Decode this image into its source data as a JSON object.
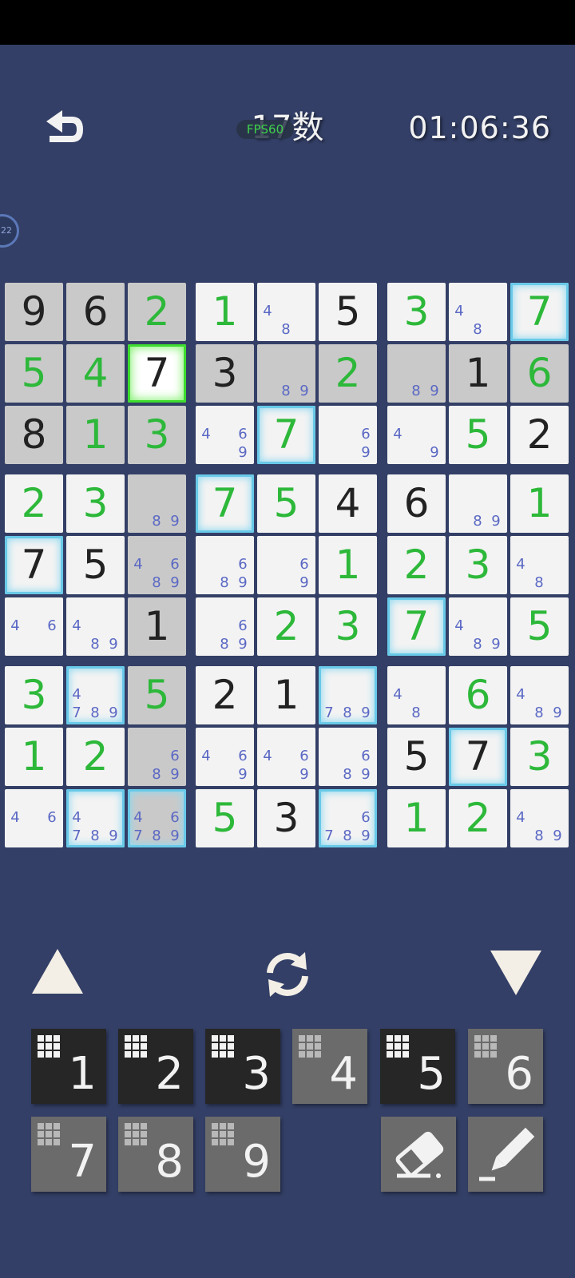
{
  "header": {
    "title": "17数",
    "fps": "FPS60",
    "timer": "01:06:36",
    "badge": "22"
  },
  "colors": {
    "background": "#333f66",
    "given_digit": "#222222",
    "user_digit": "#2db83a",
    "note_digit": "#5a68c4",
    "highlight": "#69c9e8",
    "selected": "#3ddc2f"
  },
  "board": {
    "rows": [
      [
        {
          "v": "9",
          "t": "given",
          "gray": true
        },
        {
          "v": "6",
          "t": "given",
          "gray": true
        },
        {
          "v": "2",
          "t": "user",
          "gray": true
        },
        {
          "v": "1",
          "t": "user"
        },
        {
          "n": [
            "4",
            "8"
          ]
        },
        {
          "v": "5",
          "t": "given"
        },
        {
          "v": "3",
          "t": "user"
        },
        {
          "n": [
            "4",
            "8"
          ]
        },
        {
          "v": "7",
          "t": "user",
          "glow": true
        }
      ],
      [
        {
          "v": "5",
          "t": "user",
          "gray": true
        },
        {
          "v": "4",
          "t": "user",
          "gray": true
        },
        {
          "v": "7",
          "t": "given",
          "selected": true
        },
        {
          "v": "3",
          "t": "given",
          "gray": true
        },
        {
          "n": [
            "8",
            "9"
          ],
          "gray": true
        },
        {
          "v": "2",
          "t": "user",
          "gray": true
        },
        {
          "n": [
            "8",
            "9"
          ],
          "gray": true
        },
        {
          "v": "1",
          "t": "given",
          "gray": true
        },
        {
          "v": "6",
          "t": "user",
          "gray": true
        }
      ],
      [
        {
          "v": "8",
          "t": "given",
          "gray": true
        },
        {
          "v": "1",
          "t": "user",
          "gray": true
        },
        {
          "v": "3",
          "t": "user",
          "gray": true
        },
        {
          "n": [
            "4",
            "6",
            "9"
          ]
        },
        {
          "v": "7",
          "t": "user",
          "glow": true
        },
        {
          "n": [
            "6",
            "9"
          ]
        },
        {
          "n": [
            "4",
            "9"
          ]
        },
        {
          "v": "5",
          "t": "user"
        },
        {
          "v": "2",
          "t": "given"
        }
      ],
      [
        {
          "v": "2",
          "t": "user"
        },
        {
          "v": "3",
          "t": "user"
        },
        {
          "n": [
            "8",
            "9"
          ],
          "gray": true
        },
        {
          "v": "7",
          "t": "user",
          "glow": true
        },
        {
          "v": "5",
          "t": "user"
        },
        {
          "v": "4",
          "t": "given"
        },
        {
          "v": "6",
          "t": "given"
        },
        {
          "n": [
            "8",
            "9"
          ]
        },
        {
          "v": "1",
          "t": "user"
        }
      ],
      [
        {
          "v": "7",
          "t": "given",
          "glow": true
        },
        {
          "v": "5",
          "t": "given"
        },
        {
          "n": [
            "4",
            "6",
            "8",
            "9"
          ],
          "gray": true
        },
        {
          "n": [
            "6",
            "8",
            "9"
          ]
        },
        {
          "n": [
            "6",
            "9"
          ]
        },
        {
          "v": "1",
          "t": "user"
        },
        {
          "v": "2",
          "t": "user"
        },
        {
          "v": "3",
          "t": "user"
        },
        {
          "n": [
            "4",
            "8"
          ]
        }
      ],
      [
        {
          "n": [
            "4",
            "6"
          ]
        },
        {
          "n": [
            "4",
            "8",
            "9"
          ]
        },
        {
          "v": "1",
          "t": "given",
          "gray": true
        },
        {
          "n": [
            "6",
            "8",
            "9"
          ]
        },
        {
          "v": "2",
          "t": "user"
        },
        {
          "v": "3",
          "t": "user"
        },
        {
          "v": "7",
          "t": "user",
          "glow": true
        },
        {
          "n": [
            "4",
            "8",
            "9"
          ]
        },
        {
          "v": "5",
          "t": "user"
        }
      ],
      [
        {
          "v": "3",
          "t": "user"
        },
        {
          "n": [
            "4",
            "7",
            "8",
            "9"
          ],
          "glow": true
        },
        {
          "v": "5",
          "t": "user",
          "gray": true
        },
        {
          "v": "2",
          "t": "given"
        },
        {
          "v": "1",
          "t": "given"
        },
        {
          "n": [
            "7",
            "8",
            "9"
          ],
          "glow": true
        },
        {
          "n": [
            "4",
            "8"
          ]
        },
        {
          "v": "6",
          "t": "user"
        },
        {
          "n": [
            "4",
            "8",
            "9"
          ]
        }
      ],
      [
        {
          "v": "1",
          "t": "user"
        },
        {
          "v": "2",
          "t": "user"
        },
        {
          "n": [
            "6",
            "8",
            "9"
          ],
          "gray": true
        },
        {
          "n": [
            "4",
            "6",
            "9"
          ]
        },
        {
          "n": [
            "4",
            "6",
            "9"
          ]
        },
        {
          "n": [
            "6",
            "8",
            "9"
          ]
        },
        {
          "v": "5",
          "t": "given"
        },
        {
          "v": "7",
          "t": "given",
          "glow": true
        },
        {
          "v": "3",
          "t": "user"
        }
      ],
      [
        {
          "n": [
            "4",
            "6"
          ]
        },
        {
          "n": [
            "4",
            "7",
            "8",
            "9"
          ],
          "glow": true
        },
        {
          "n": [
            "4",
            "6",
            "7",
            "8",
            "9"
          ],
          "gray": true,
          "glow": true
        },
        {
          "v": "5",
          "t": "user"
        },
        {
          "v": "3",
          "t": "given"
        },
        {
          "n": [
            "6",
            "7",
            "8",
            "9"
          ],
          "glow": true
        },
        {
          "v": "1",
          "t": "user"
        },
        {
          "v": "2",
          "t": "user"
        },
        {
          "n": [
            "4",
            "8",
            "9"
          ]
        }
      ]
    ]
  },
  "controls": {
    "up_icon": "triangle-up-icon",
    "refresh_icon": "refresh-icon",
    "down_icon": "triangle-down-icon"
  },
  "keypad": {
    "keys": [
      {
        "label": "1",
        "style": "dark"
      },
      {
        "label": "2",
        "style": "dark"
      },
      {
        "label": "3",
        "style": "dark"
      },
      {
        "label": "4",
        "style": "light"
      },
      {
        "label": "5",
        "style": "dark"
      },
      {
        "label": "6",
        "style": "light"
      },
      {
        "label": "7",
        "style": "light"
      },
      {
        "label": "8",
        "style": "light"
      },
      {
        "label": "9",
        "style": "light"
      }
    ],
    "eraser_icon": "eraser-icon",
    "pencil_icon": "pencil-icon"
  }
}
